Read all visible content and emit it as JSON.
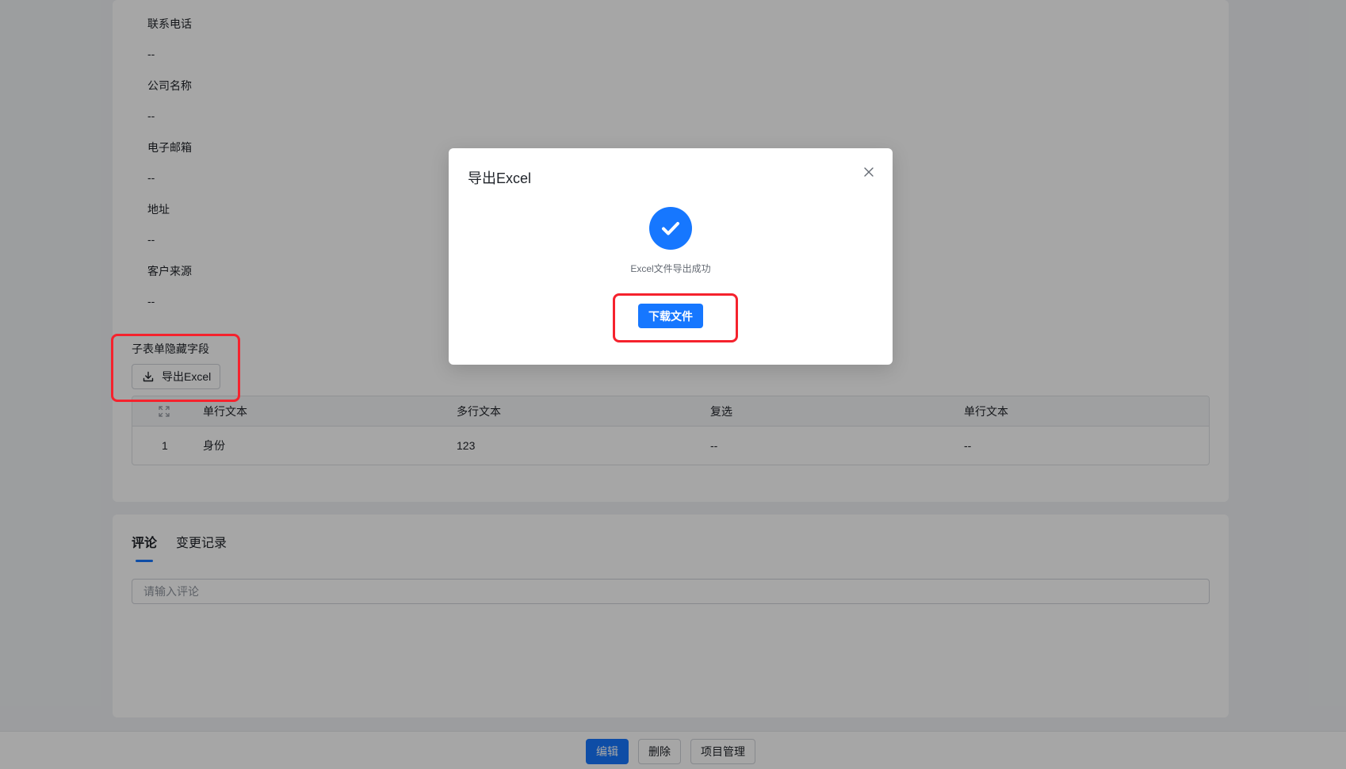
{
  "detail": {
    "fields": [
      {
        "label": "联系电话",
        "value": "--"
      },
      {
        "label": "公司名称",
        "value": "--"
      },
      {
        "label": "电子邮箱",
        "value": "--"
      },
      {
        "label": "地址",
        "value": "--"
      },
      {
        "label": "客户来源",
        "value": "--"
      }
    ],
    "subtable": {
      "title": "子表单隐藏字段",
      "export_label": "导出Excel",
      "columns": [
        "单行文本",
        "多行文本",
        "复选",
        "单行文本"
      ],
      "rows": [
        {
          "index": "1",
          "cells": [
            "身份",
            "123",
            "--",
            "--"
          ]
        }
      ]
    }
  },
  "comments": {
    "tabs": [
      {
        "label": "评论",
        "active": true
      },
      {
        "label": "变更记录",
        "active": false
      }
    ],
    "input_placeholder": "请输入评论"
  },
  "bottom_bar": {
    "edit_label": "编辑",
    "delete_label": "删除",
    "project_label": "项目管理"
  },
  "modal": {
    "title": "导出Excel",
    "message": "Excel文件导出成功",
    "download_label": "下载文件"
  },
  "colors": {
    "primary": "#1677ff",
    "highlight": "#f5222d"
  }
}
